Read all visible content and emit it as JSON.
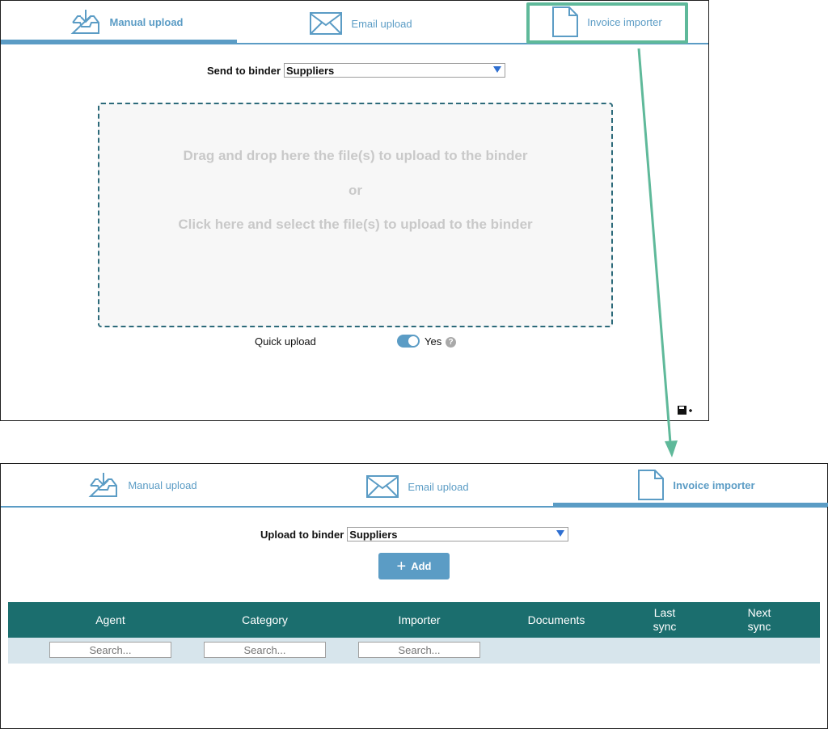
{
  "colors": {
    "accent": "#5b9cc5",
    "table_header": "#1b6e6e",
    "filter_row": "#d7e5ec",
    "highlight": "#5fb99a",
    "dropzone_border": "#2c6a7a"
  },
  "top": {
    "tabs": [
      {
        "label": "Manual upload",
        "icon": "inbox-download-icon",
        "active": true
      },
      {
        "label": "Email upload",
        "icon": "envelope-icon",
        "active": false
      },
      {
        "label": "Invoice importer",
        "icon": "document-icon",
        "active": false
      }
    ],
    "binder_label": "Send to binder",
    "binder_value": "Suppliers",
    "dropzone": {
      "line1": "Drag and drop here the file(s) to upload to the binder",
      "or": "or",
      "line2": "Click here and select the file(s) to upload to the binder"
    },
    "quick_upload_label": "Quick upload",
    "quick_upload_value": "Yes",
    "quick_upload_on": true,
    "help_glyph": "?"
  },
  "bottom": {
    "tabs": [
      {
        "label": "Manual upload",
        "icon": "inbox-download-icon",
        "active": false
      },
      {
        "label": "Email upload",
        "icon": "envelope-icon",
        "active": false
      },
      {
        "label": "Invoice importer",
        "icon": "document-icon",
        "active": true
      }
    ],
    "binder_label": "Upload to binder",
    "binder_value": "Suppliers",
    "add_label": "Add",
    "table": {
      "columns": [
        "Agent",
        "Category",
        "Importer",
        "Documents",
        "Last\nsync",
        "Next\nsync"
      ],
      "search_placeholder": "Search..."
    }
  }
}
